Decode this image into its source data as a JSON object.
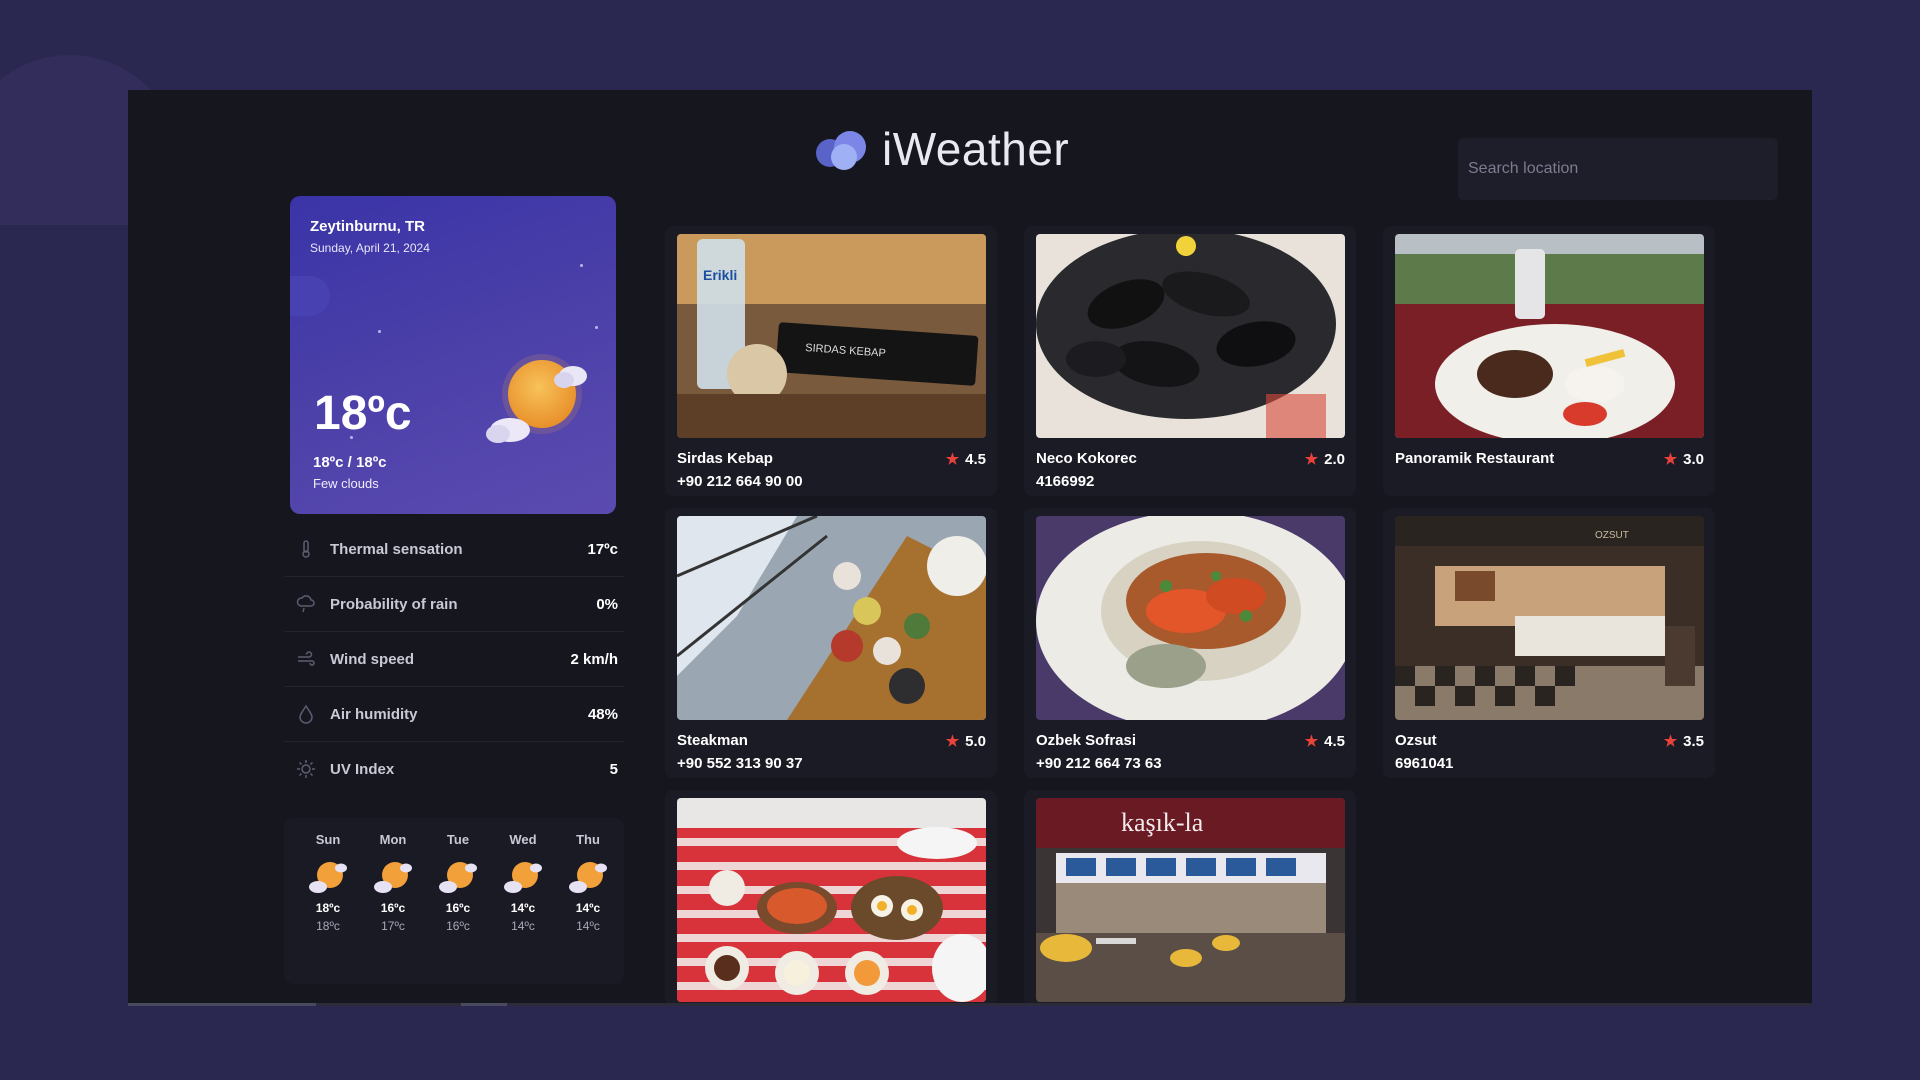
{
  "app": {
    "name": "iWeather"
  },
  "search": {
    "placeholder": "Search location"
  },
  "weather": {
    "city": "Zeytinburnu, TR",
    "date": "Sunday, April 21, 2024",
    "temp": "18ºc",
    "range": "18ºc / 18ºc",
    "description": "Few clouds",
    "icon": "sun-cloud-icon"
  },
  "details": [
    {
      "label": "Thermal sensation",
      "value": "17ºc",
      "icon": "thermometer-icon"
    },
    {
      "label": "Probability of rain",
      "value": "0%",
      "icon": "rain-cloud-icon"
    },
    {
      "label": "Wind speed",
      "value": "2 km/h",
      "icon": "wind-icon"
    },
    {
      "label": "Air humidity",
      "value": "48%",
      "icon": "droplet-icon"
    },
    {
      "label": "UV Index",
      "value": "5",
      "icon": "sun-icon"
    }
  ],
  "forecast": [
    {
      "day": "Sun",
      "max": "18ºc",
      "min": "18ºc"
    },
    {
      "day": "Mon",
      "max": "16ºc",
      "min": "17ºc"
    },
    {
      "day": "Tue",
      "max": "16ºc",
      "min": "16ºc"
    },
    {
      "day": "Wed",
      "max": "14ºc",
      "min": "14ºc"
    },
    {
      "day": "Thu",
      "max": "14ºc",
      "min": "14ºc"
    }
  ],
  "restaurants": [
    {
      "name": "Sirdas Kebap",
      "phone": "+90 212 664 90 00",
      "rating": "4.5"
    },
    {
      "name": "Neco Kokorec",
      "phone": "4166992",
      "rating": "2.0"
    },
    {
      "name": "Panoramik Restaurant",
      "phone": "",
      "rating": "3.0"
    },
    {
      "name": "Steakman",
      "phone": "+90 552 313 90 37",
      "rating": "5.0"
    },
    {
      "name": "Ozbek Sofrasi",
      "phone": "+90 212 664 73 63",
      "rating": "4.5"
    },
    {
      "name": "Ozsut",
      "phone": "6961041",
      "rating": "3.5"
    },
    {
      "name": "",
      "phone": "",
      "rating": ""
    },
    {
      "name": "",
      "phone": "",
      "rating": ""
    }
  ],
  "photo_signs": {
    "bottle": "Erikli",
    "kebap": "SIRDAS KEBAP",
    "ozsut": "OZSUT",
    "kasikla": "kaşık-la"
  },
  "colors": {
    "accent": "#4b41b0",
    "star": "#e8423a",
    "sun": "#f2a03a",
    "panel": "#16161f"
  }
}
